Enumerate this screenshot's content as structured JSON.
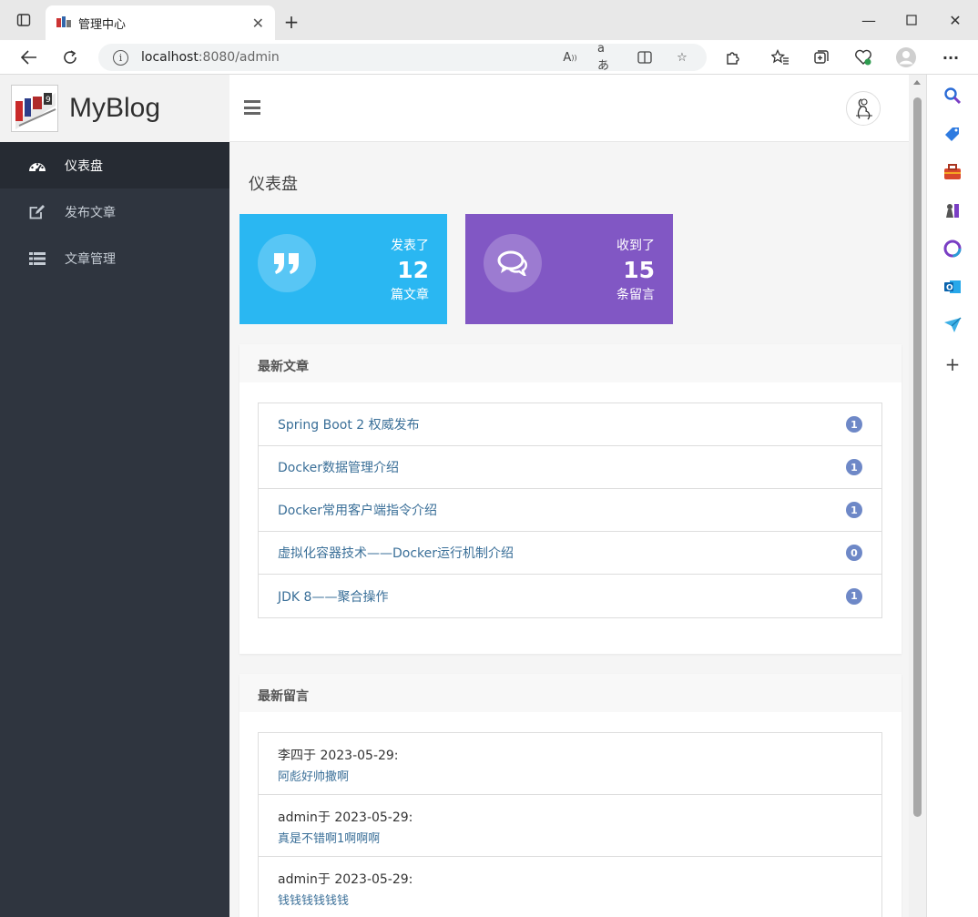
{
  "browser": {
    "tab_title": "管理中心",
    "url_host": "localhost",
    "url_path": ":8080/admin"
  },
  "sidebar": {
    "brand": "MyBlog",
    "items": [
      {
        "label": "仪表盘",
        "icon": "dashboard-icon",
        "active": true
      },
      {
        "label": "发布文章",
        "icon": "edit-icon",
        "active": false
      },
      {
        "label": "文章管理",
        "icon": "list-icon",
        "active": false
      }
    ]
  },
  "page": {
    "title": "仪表盘"
  },
  "stats": [
    {
      "prefix": "发表了",
      "value": "12",
      "suffix": "篇文章",
      "color": "#2ab7f2",
      "icon": "quote-icon"
    },
    {
      "prefix": "收到了",
      "value": "15",
      "suffix": "条留言",
      "color": "#8157c4",
      "icon": "comments-icon"
    }
  ],
  "latest_posts": {
    "heading": "最新文章",
    "items": [
      {
        "title": "Spring Boot 2 权威发布",
        "count": "1"
      },
      {
        "title": "Docker数据管理介绍",
        "count": "1"
      },
      {
        "title": "Docker常用客户端指令介绍",
        "count": "1"
      },
      {
        "title": "虚拟化容器技术——Docker运行机制介绍",
        "count": "0"
      },
      {
        "title": "JDK 8——聚合操作",
        "count": "1"
      }
    ]
  },
  "latest_comments": {
    "heading": "最新留言",
    "items": [
      {
        "author_date": "李四于 2023-05-29:",
        "content": "阿彪好帅撒啊"
      },
      {
        "author_date": "admin于 2023-05-29:",
        "content": "真是不错啊1啊啊啊"
      },
      {
        "author_date": "admin于 2023-05-29:",
        "content": "钱钱钱钱钱钱"
      }
    ]
  }
}
